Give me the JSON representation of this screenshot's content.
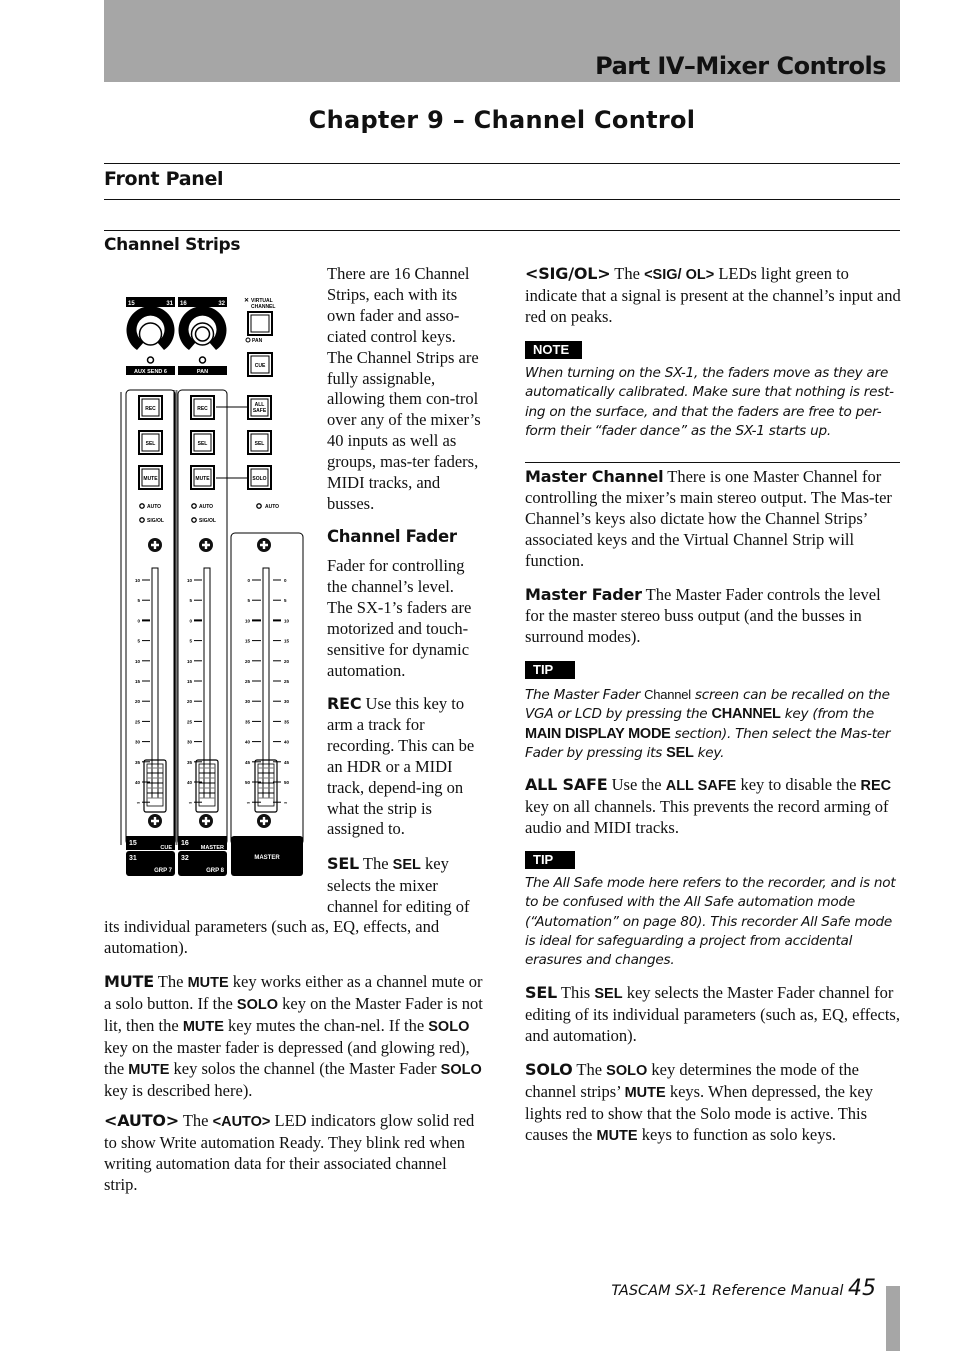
{
  "header": {
    "part_title": "Part IV–Mixer Controls",
    "chapter_title": "Chapter 9 – Channel Control"
  },
  "section": {
    "title": "Front Panel",
    "subsection": "Channel Strips"
  },
  "illustration": {
    "knobs": [
      {
        "top_left": "15",
        "top_right": "31",
        "label": "AUX SEND 6"
      },
      {
        "top_left": "16",
        "top_right": "32",
        "label": "PAN"
      }
    ],
    "virtual_channel_label_1": "VIRTUAL",
    "virtual_channel_label_2": "CHANNEL",
    "pan_led": "PAN",
    "cue_key": "CUE",
    "strip_keys": [
      "REC",
      "SEL",
      "MUTE"
    ],
    "master_keys": [
      "ALL",
      "SAFE",
      "SEL",
      "SOLO"
    ],
    "led_auto": "AUTO",
    "led_sigol": "SIG/OL",
    "channel_scale": [
      "10",
      "5",
      "0",
      "5",
      "10",
      "15",
      "20",
      "25",
      "30",
      "35",
      "40",
      "∞"
    ],
    "master_scale": [
      "0",
      "5",
      "10",
      "15",
      "20",
      "25",
      "30",
      "35",
      "40",
      "45",
      "50",
      "∞"
    ],
    "strip_labels": [
      {
        "num_a": "15",
        "name_a": "CUE",
        "num_b": "31",
        "name_b": "GRP 7"
      },
      {
        "num_a": "16",
        "name_a": "MASTER",
        "num_b": "32",
        "name_b": "GRP 8"
      }
    ],
    "master_label": "MASTER"
  },
  "left": {
    "intro": "There are 16 Channel Strips, each with its own fader and asso-ciated control keys. The Channel Strips are fully assignable, allowing them con-trol over any of the mixer’s 40 inputs as well as groups, mas-ter faders, MIDI tracks, and busses.",
    "fader_heading": "Channel Fader",
    "fader_text": "Fader for controlling the channel’s level. The SX-1’s faders are motorized and touch-sensitive for dynamic automation.",
    "rec_lead": "REC",
    "rec_text": " Use this key to arm a track for recording. This can be an HDR or a MIDI track, depend-ing on what the strip is assigned to.",
    "sel_lead": "SEL",
    "sel_text_1": " The ",
    "sel_key": "SEL",
    "sel_text_2": " key selects the mixer channel for editing of",
    "sel_text_3": "its individual parameters (such as, EQ, effects, and automation).",
    "mute_lead": "MUTE",
    "mute_t1": " The ",
    "mute_k1": "MUTE",
    "mute_t2": " key works either as a channel mute or a solo button. If the ",
    "mute_k2": "SOLO",
    "mute_t3": " key on the Master Fader is not lit, then the ",
    "mute_k3": "MUTE",
    "mute_t4": " key mutes the chan-nel. If the ",
    "mute_k4": "SOLO",
    "mute_t5": " key on the master fader is depressed (and glowing red), the ",
    "mute_k5": "MUTE",
    "mute_t6": " key solos the channel (the Master Fader ",
    "mute_k6": "SOLO",
    "mute_t7": " key is described here).",
    "auto_lead": "<AUTO>",
    "auto_t1": " The ",
    "auto_k1": "<AUTO>",
    "auto_t2": " LED indicators glow solid red to show Write automation Ready. They blink red when writing automation data for their associated channel strip."
  },
  "right": {
    "sigol_lead": "<SIG/OL>",
    "sigol_t1": " The ",
    "sigol_k1": "<SIG/ OL>",
    "sigol_t2": " LEDs light green to indicate that a signal is present at the channel’s input and red on peaks.",
    "note_label": "NOTE",
    "note_text": "When turning on the SX-1, the faders move as they are automatically calibrated. Make sure that nothing is rest-ing on the surface, and that the faders are free to per-form their “fader dance” as the SX-1 starts up.",
    "master_channel_lead": "Master Channel",
    "master_channel_text": " There is one Master Channel for controlling the mixer’s main stereo output. The Mas-ter Channel’s keys also dictate how the Channel Strips’ associated keys and the Virtual Channel Strip will function.",
    "master_fader_lead": "Master Fader",
    "master_fader_text": " The Master Fader controls the level for the master stereo buss output (and the busses in surround modes).",
    "tip1_label": "TIP",
    "tip1_t1": "The Master Fader ",
    "tip1_c1": "Channel",
    "tip1_t2": " screen can be recalled on the VGA or LCD by pressing the ",
    "tip1_k1": "CHANNEL",
    "tip1_t3": " key (from the ",
    "tip1_k2": "MAIN DISPLAY MODE",
    "tip1_t4": " section). Then select the Mas-ter Fader by pressing its ",
    "tip1_k3": "SEL",
    "tip1_t5": " key.",
    "allsafe_lead": "ALL SAFE",
    "allsafe_t1": " Use the ",
    "allsafe_k1": "ALL SAFE",
    "allsafe_t2": " key to disable the ",
    "allsafe_k2": "REC",
    "allsafe_t3": " key on all channels. This prevents the record arming of audio and MIDI tracks.",
    "tip2_label": "TIP",
    "tip2_text": "The All Safe mode here refers to the recorder, and is not to be confused with the All Safe automation mode (“Automation” on page 80). This recorder All Safe mode is ideal for safeguarding a project from accidental erasures and changes.",
    "sel_lead": "SEL",
    "sel_t1": " This ",
    "sel_k1": "SEL",
    "sel_t2": " key selects the Master Fader channel for editing of its individual parameters (such as, EQ, effects, and automation).",
    "solo_lead": "SOLO",
    "solo_t1": " The ",
    "solo_k1": "SOLO",
    "solo_t2": " key determines the mode of the channel strips’ ",
    "solo_k2": "MUTE",
    "solo_t3": " keys. When depressed, the key lights red to show that the Solo mode is active. This causes the ",
    "solo_k3": "MUTE",
    "solo_t4": " keys to function as solo keys."
  },
  "footer": {
    "manual": "TASCAM SX-1 Reference Manual ",
    "page": "45"
  },
  "colors": {
    "header_band": "#a6a6a6",
    "text": "#111111",
    "badge_bg": "#000000"
  }
}
